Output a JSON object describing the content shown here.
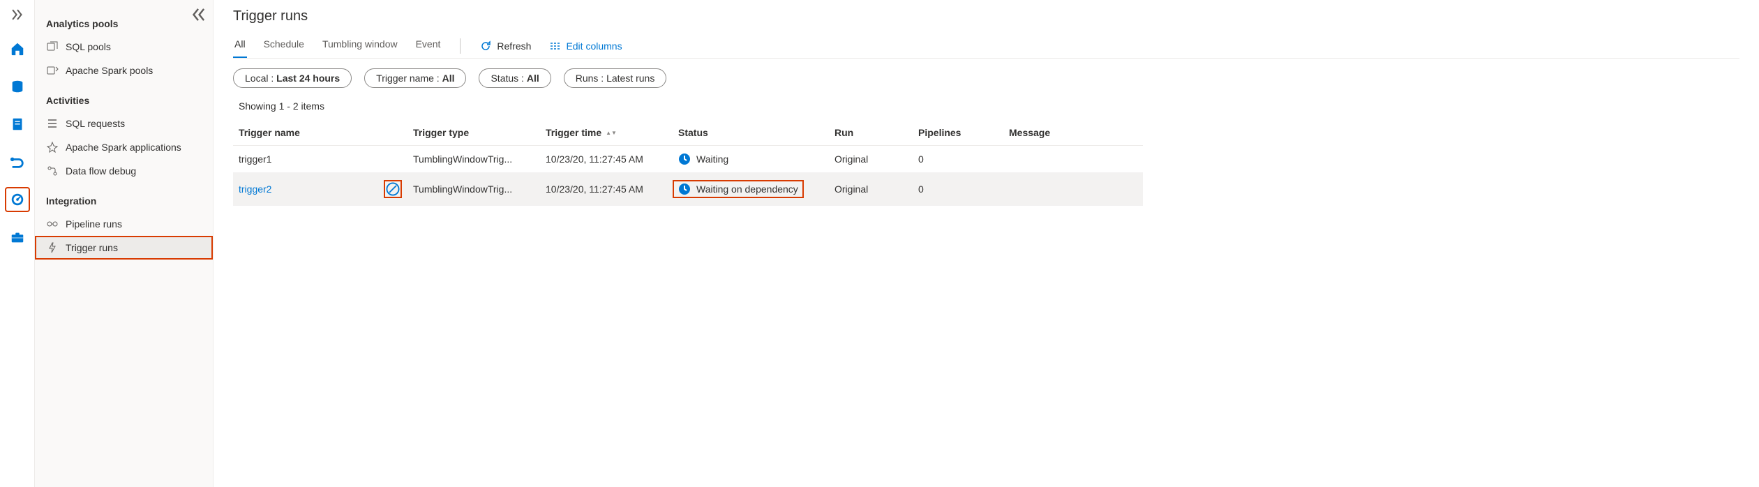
{
  "rail": {
    "icons": [
      "expand",
      "home",
      "database",
      "doc",
      "pipe",
      "monitor",
      "toolbox"
    ]
  },
  "sidebar": {
    "sections": [
      {
        "title": "Analytics pools",
        "items": [
          {
            "label": "SQL pools",
            "icon": "sql"
          },
          {
            "label": "Apache Spark pools",
            "icon": "spark"
          }
        ]
      },
      {
        "title": "Activities",
        "items": [
          {
            "label": "SQL requests",
            "icon": "list"
          },
          {
            "label": "Apache Spark applications",
            "icon": "spark"
          },
          {
            "label": "Data flow debug",
            "icon": "flow"
          }
        ]
      },
      {
        "title": "Integration",
        "items": [
          {
            "label": "Pipeline runs",
            "icon": "pipeline"
          },
          {
            "label": "Trigger runs",
            "icon": "trigger",
            "active": true,
            "highlighted": true
          }
        ]
      }
    ]
  },
  "main": {
    "title": "Trigger runs",
    "tabs": [
      "All",
      "Schedule",
      "Tumbling window",
      "Event"
    ],
    "active_tab": 0,
    "actions": {
      "refresh": "Refresh",
      "edit_columns": "Edit columns"
    },
    "filters": [
      {
        "label": "Local : ",
        "value": "Last 24 hours"
      },
      {
        "label": "Trigger name : ",
        "value": "All"
      },
      {
        "label": "Status : ",
        "value": "All"
      },
      {
        "label": "Runs : ",
        "value": "Latest runs"
      }
    ],
    "showing": "Showing 1 - 2 items",
    "columns": [
      "Trigger name",
      "Trigger type",
      "Trigger time",
      "Status",
      "Run",
      "Pipelines",
      "Message"
    ],
    "sort_col": 2,
    "rows": [
      {
        "name": "trigger1",
        "type": "TumblingWindowTrig...",
        "time": "10/23/20, 11:27:45 AM",
        "status": "Waiting",
        "run": "Original",
        "pipelines": "0",
        "message": "",
        "hover": false,
        "link": false,
        "cancel_highlight": false,
        "status_highlight": false
      },
      {
        "name": "trigger2",
        "type": "TumblingWindowTrig...",
        "time": "10/23/20, 11:27:45 AM",
        "status": "Waiting on dependency",
        "run": "Original",
        "pipelines": "0",
        "message": "",
        "hover": true,
        "link": true,
        "cancel_highlight": true,
        "status_highlight": true
      }
    ]
  },
  "colors": {
    "accent": "#0078d4",
    "highlight": "#d83b01"
  }
}
